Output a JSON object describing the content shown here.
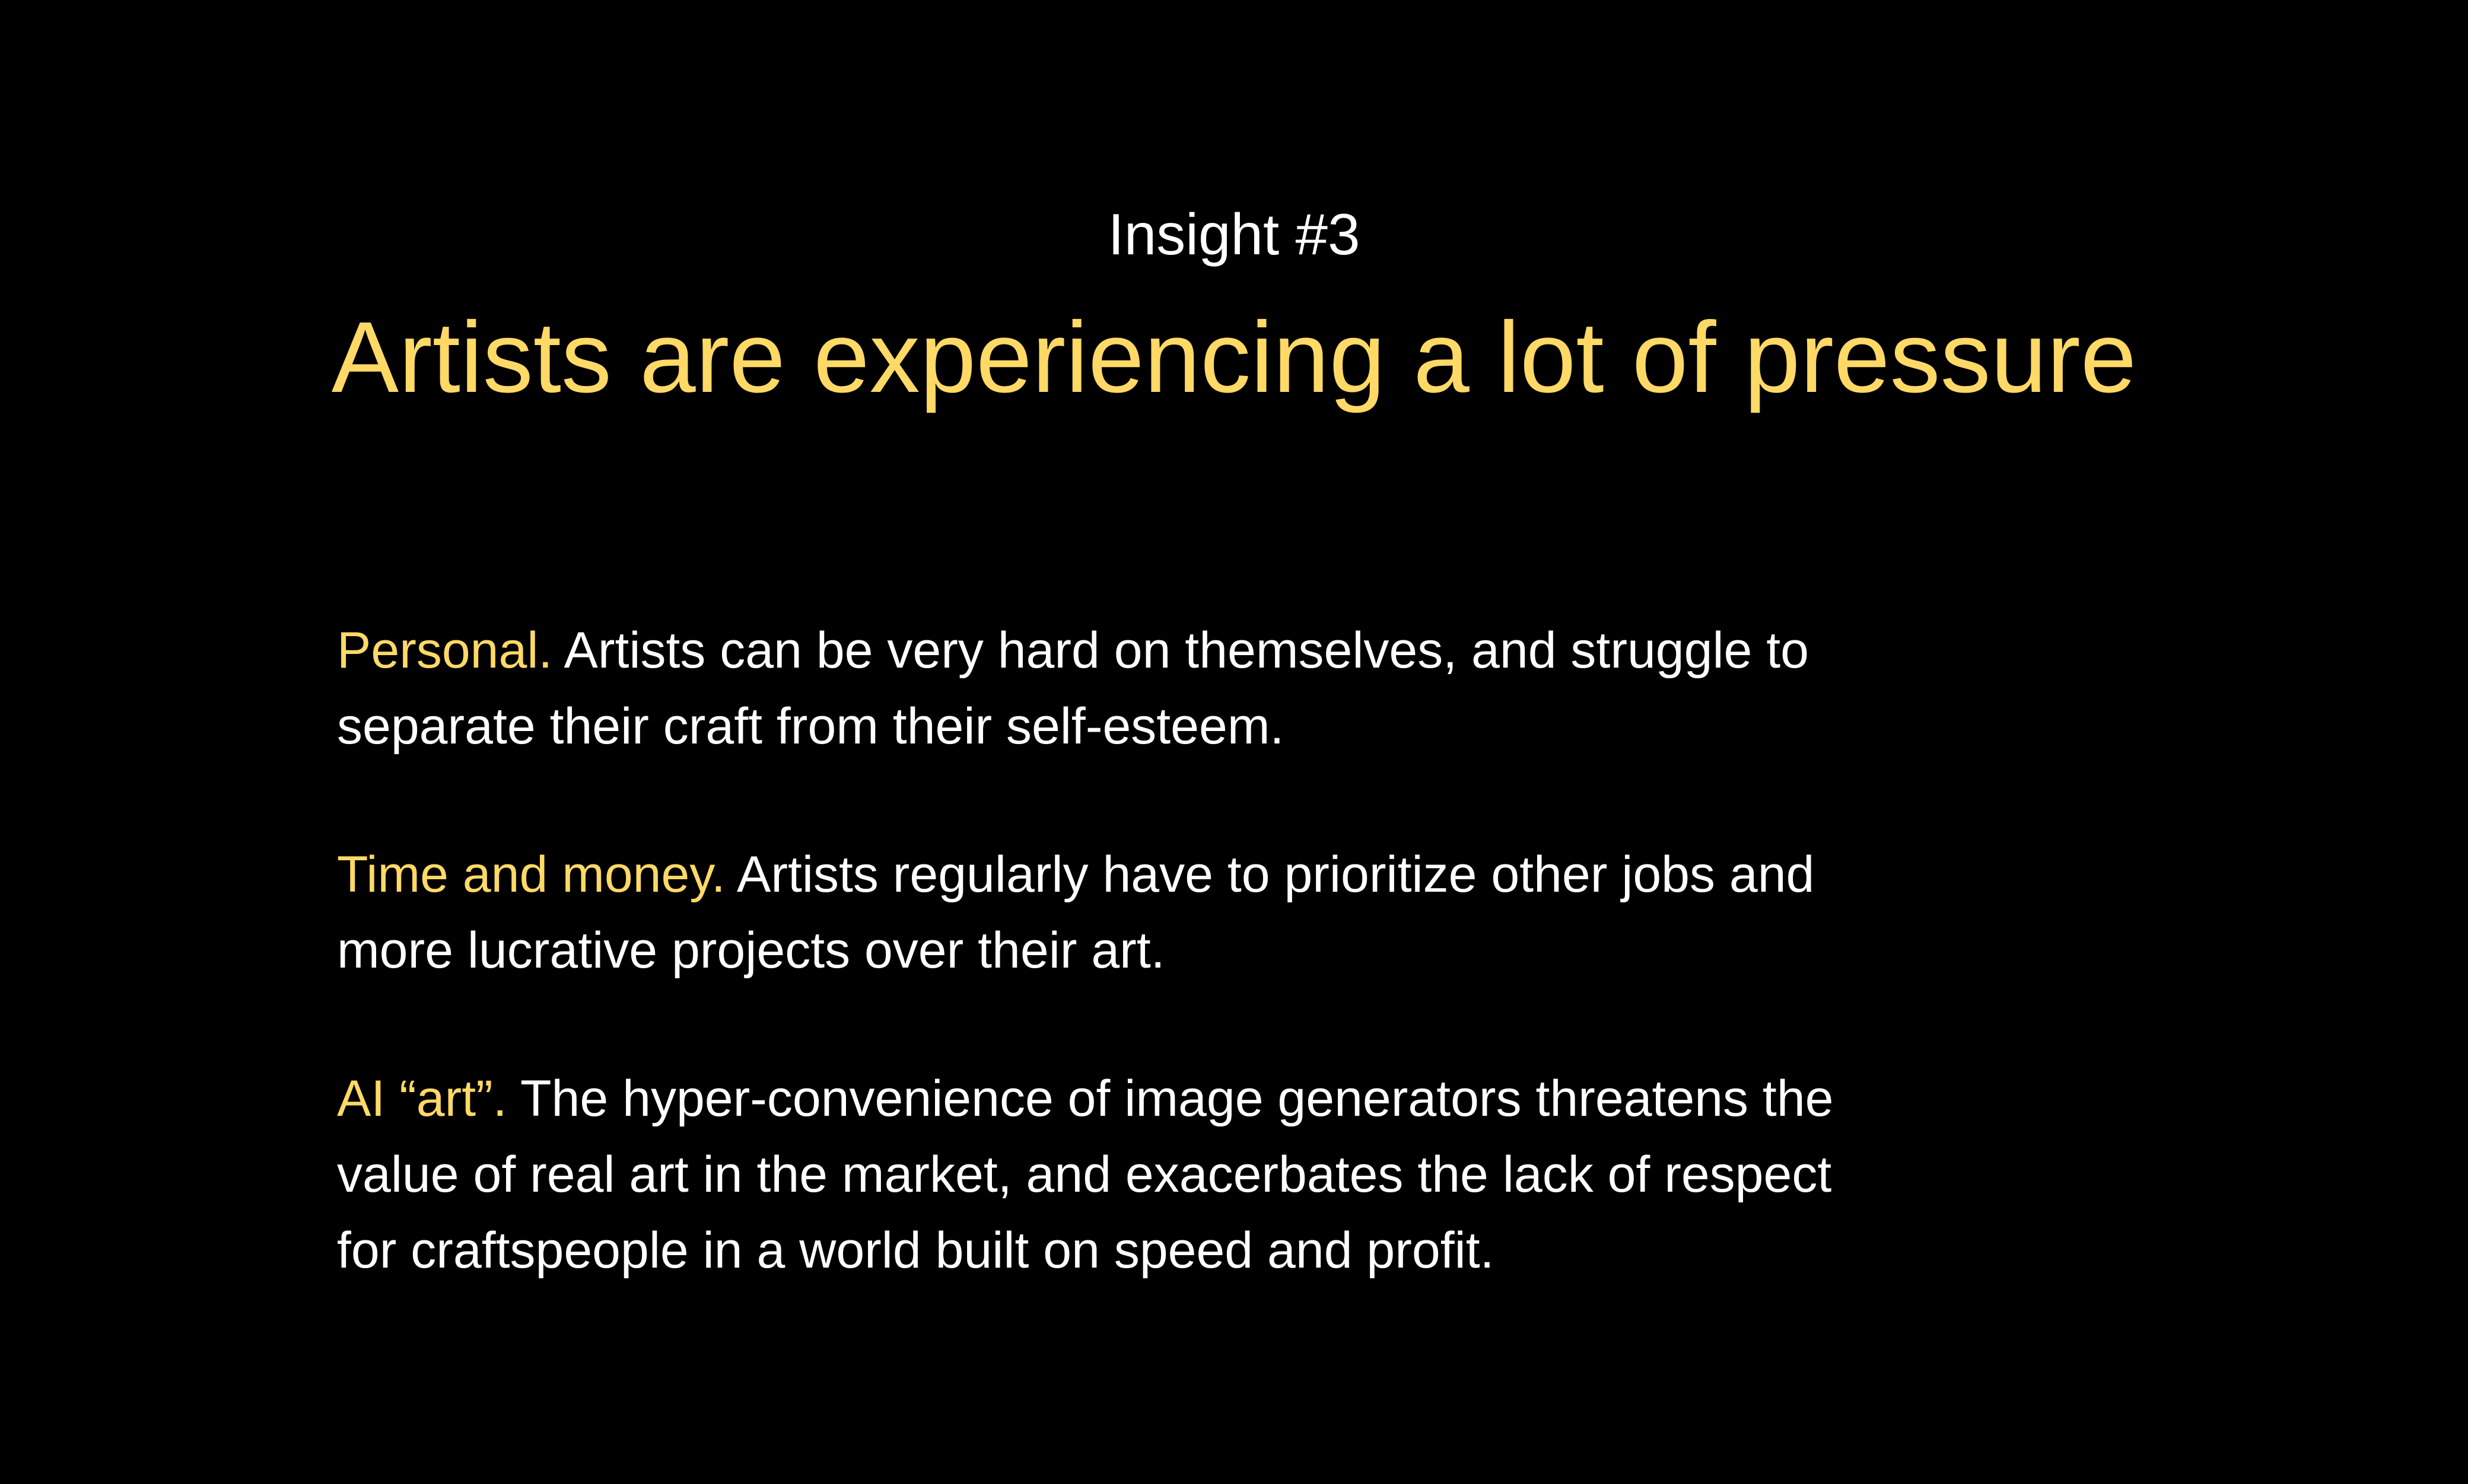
{
  "slide": {
    "eyebrow": "Insight #3",
    "headline": "Artists are experiencing a lot of pressure",
    "paragraphs": [
      {
        "lead": "Personal.",
        "text": " Artists can be very hard on themselves, and struggle to separate their craft from their self-esteem."
      },
      {
        "lead": "Time and money.",
        "text": " Artists regularly have to prioritize other jobs and more lucrative projects over their art."
      },
      {
        "lead": "AI “art”.",
        "text": " The hyper-convenience of image generators threatens the value of real art in the market, and exacerbates the lack of respect for craftspeople in a world built on speed and profit."
      }
    ]
  },
  "colors": {
    "background": "#000000",
    "accent": "#ffd966",
    "text": "#ffffff"
  }
}
